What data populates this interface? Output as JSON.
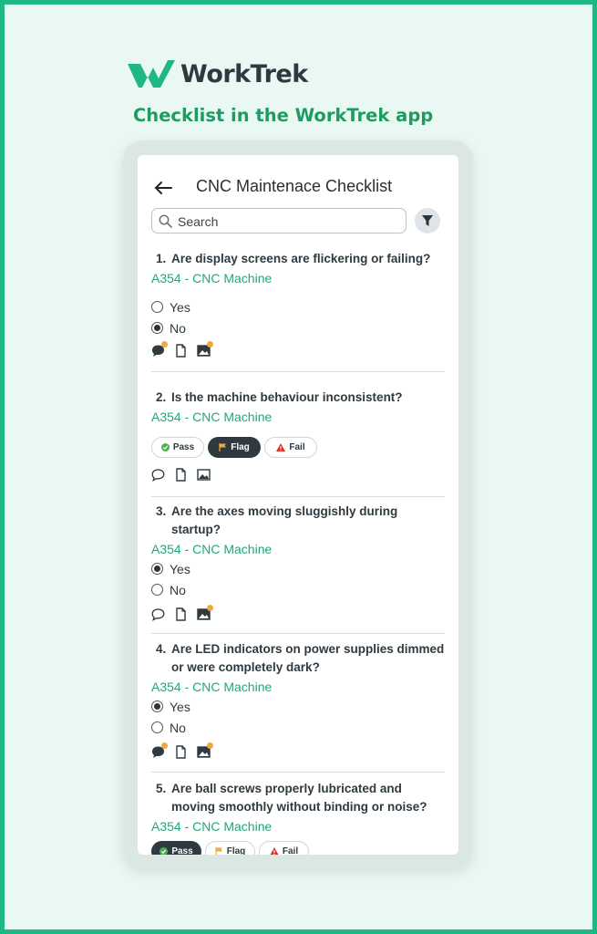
{
  "brand": {
    "name": "WorkTrek",
    "tagline": "Checklist in the WorkTrek app"
  },
  "header": {
    "title": "CNC Maintenace Checklist"
  },
  "search": {
    "placeholder": "Search"
  },
  "questions": [
    {
      "num": "1.",
      "text": "Are display screens are flickering or failing?",
      "asset": "A354 - CNC Machine",
      "options": [
        "Yes",
        "No"
      ],
      "selected": "No"
    },
    {
      "num": "2.",
      "text": "Is the machine behaviour inconsistent?",
      "asset": "A354 - CNC Machine",
      "pills": [
        "Pass",
        "Flag",
        "Fail"
      ],
      "selected": "Flag"
    },
    {
      "num": "3.",
      "text": "Are the axes moving sluggishly during startup?",
      "asset": "A354 - CNC Machine",
      "options": [
        "Yes",
        "No"
      ],
      "selected": "Yes"
    },
    {
      "num": "4.",
      "text": "Are LED indicators on power supplies dimmed or were completely dark?",
      "asset": "A354 - CNC Machine",
      "options": [
        "Yes",
        "No"
      ],
      "selected": "Yes"
    },
    {
      "num": "5.",
      "text": "Are ball screws properly lubricated and moving smoothly without binding or noise?",
      "asset": "A354 - CNC Machine",
      "pills": [
        "Pass",
        "Flag",
        "Fail"
      ],
      "selected": "Pass"
    }
  ],
  "colors": {
    "brand_green": "#1fb784",
    "asset_green": "#1eaa72",
    "badge_orange": "#f2a93b"
  }
}
